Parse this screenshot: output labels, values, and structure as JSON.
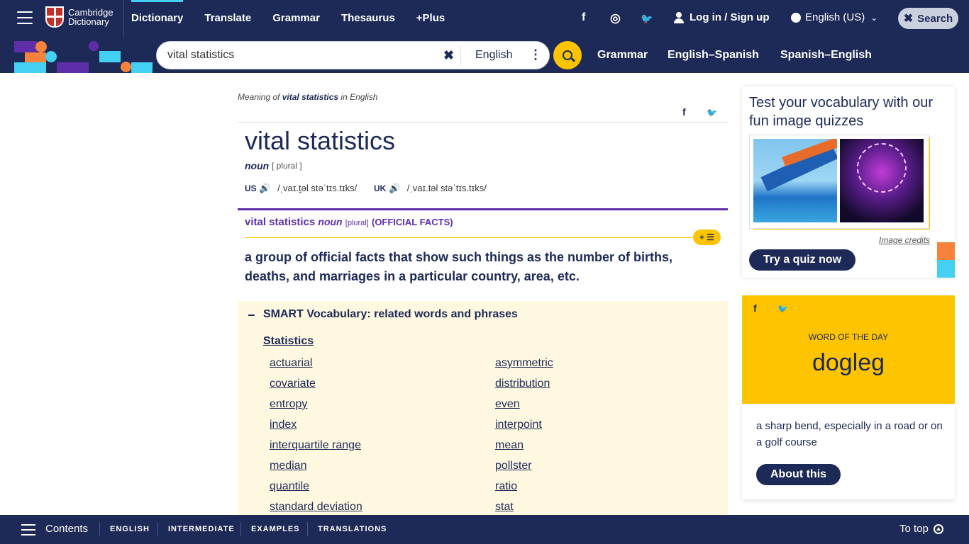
{
  "header": {
    "logo_line1": "Cambridge",
    "logo_line2": "Dictionary",
    "nav": [
      "Dictionary",
      "Translate",
      "Grammar",
      "Thesaurus",
      "+Plus"
    ],
    "social": [
      "f",
      "◎",
      "🐦"
    ],
    "login_label": "Log in / Sign up",
    "language": "English (US)",
    "search_label": "Search"
  },
  "search": {
    "value": "vital statistics",
    "dictionary": "English"
  },
  "subnav": [
    "Grammar",
    "English–Spanish",
    "Spanish–English"
  ],
  "entry": {
    "meaning_prefix": "Meaning of ",
    "meaning_word": "vital statistics",
    "meaning_suffix": " in English",
    "headword": "vital statistics",
    "pos": "noun",
    "grammar": "[ plural ]",
    "us_label": "US",
    "us_pron": "/ˌvaɪ.t̬əl stəˈtɪs.tɪks/",
    "uk_label": "UK",
    "uk_pron": "/ˌvaɪ.təl stəˈtɪs.tɪks/",
    "sense_word": "vital statistics",
    "sense_pos": "noun",
    "sense_grammar": "[plural]",
    "sense_guide": "(OFFICIAL FACTS)",
    "add_list": "+ ☰",
    "definition": "a group of official facts that show such things as the number of births, deaths, and marriages in a particular country, area, etc."
  },
  "smart_vocab": {
    "toggle": "−",
    "title": "SMART Vocabulary: related words and phrases",
    "category": "Statistics",
    "left": [
      "actuarial",
      "covariate",
      "entropy",
      "index",
      "interquartile range",
      "median",
      "quantile",
      "standard deviation"
    ],
    "right": [
      "asymmetric",
      "distribution",
      "even",
      "interpoint",
      "mean",
      "pollster",
      "ratio",
      "stat"
    ]
  },
  "quiz": {
    "title": "Test your vocabulary with our fun image quizzes",
    "credits": "Image credits",
    "button": "Try a quiz now"
  },
  "wotd": {
    "label": "WORD OF THE DAY",
    "word": "dogleg",
    "definition": "a sharp bend, especially in a road or on a golf course",
    "button": "About this"
  },
  "footer": {
    "contents": "Contents",
    "tabs": [
      "ENGLISH",
      "INTERMEDIATE",
      "EXAMPLES",
      "TRANSLATIONS"
    ],
    "totop": "To top"
  },
  "colors": {
    "navy": "#1d2a57",
    "yellow": "#fec400",
    "purple": "#5e2ea8",
    "cyan": "#43d0f3",
    "orange": "#f6823b"
  }
}
